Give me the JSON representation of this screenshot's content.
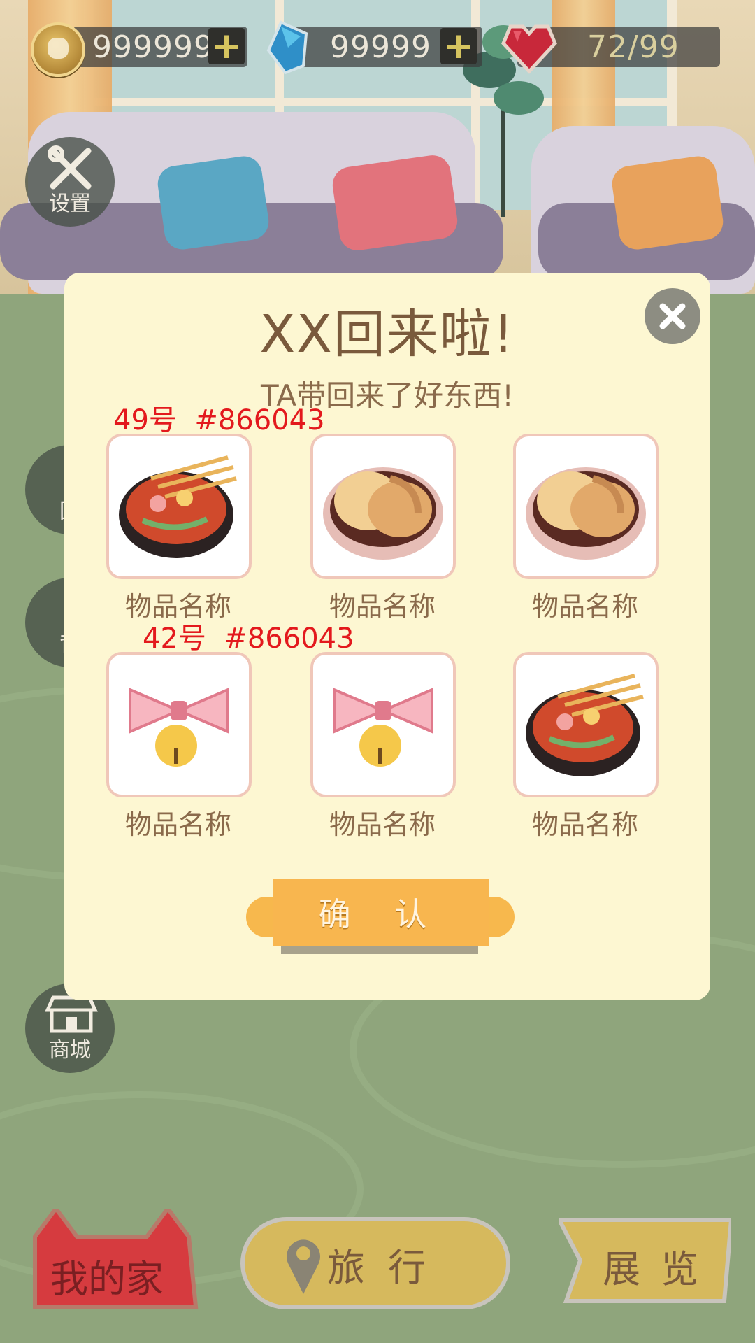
{
  "hud": {
    "coins": "999999",
    "gems": "99999",
    "hearts": "72/99",
    "plus": "+"
  },
  "side": {
    "settings": "设置",
    "recall": "回",
    "bag": "背",
    "shop": "商城"
  },
  "modal": {
    "title": "XX回来啦!",
    "subtitle": "TA带回来了好东西!",
    "confirm": "确 认",
    "items": [
      {
        "name": "物品名称",
        "icon": "hotpot-skewers-icon"
      },
      {
        "name": "物品名称",
        "icon": "mochi-bowl-icon"
      },
      {
        "name": "物品名称",
        "icon": "mochi-bowl-icon"
      },
      {
        "name": "物品名称",
        "icon": "bow-bell-icon"
      },
      {
        "name": "物品名称",
        "icon": "bow-bell-icon"
      },
      {
        "name": "物品名称",
        "icon": "hotpot-skewers-icon"
      }
    ]
  },
  "annotations": {
    "a1": "49号  #866043",
    "a2": "42号  #866043"
  },
  "nav": {
    "home": "我的家",
    "travel": "旅 行",
    "exhibit": "展 览"
  },
  "colors": {
    "text_brown": "#866043",
    "annotation_red": "#e3191d",
    "confirm_orange": "#f8b64f",
    "modal_bg": "#fdf7d2"
  }
}
